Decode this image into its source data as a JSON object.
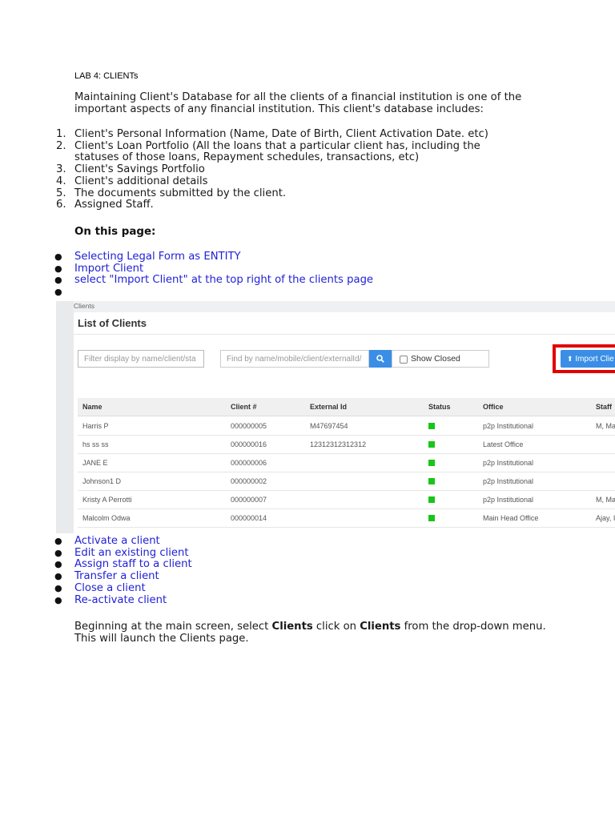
{
  "doc": {
    "title": "LAB 4: CLIENTs",
    "intro": "Maintaining Client's Database for all the clients of a financial institution is one of the important aspects of any financial institution. This client's database includes:",
    "numbered": [
      "Client's Personal Information (Name, Date of Birth, Client Activation Date. etc)",
      "Client's Loan Portfolio (All the loans that a particular client has, including the statuses of those loans, Repayment schedules, transactions, etc)",
      "Client's Savings Portfolio",
      "Client's additional details",
      "The documents submitted by the client.",
      "Assigned Staff."
    ],
    "heading": "On this page:",
    "links1": [
      "Selecting Legal Form as ENTITY",
      "Import Client",
      "select \"Import Client\" at the top right of the clients page",
      ""
    ],
    "links2": [
      " Activate a client",
      "Edit an existing client",
      "Assign staff to a client",
      "Transfer a client",
      "Close a client",
      "Re-activate client"
    ],
    "final": {
      "p1": " Beginning at the main screen, select ",
      "b1": "Clients",
      "p2": " click on ",
      "b2": "Clients",
      "p3": " from the drop-down menu. This will launch the Clients page."
    }
  },
  "screenshot": {
    "breadcrumb": "Clients",
    "panel_title": "List of Clients",
    "filter_placeholder": "Filter display by name/client/sta",
    "search_placeholder": "Find by name/mobile/client/externalId/",
    "show_closed": "Show Closed",
    "import_label": "Import Clie",
    "columns": [
      "Name",
      "Client #",
      "External Id",
      "Status",
      "Office",
      "Staff"
    ],
    "status_color": "#19c519",
    "rows": [
      {
        "name": "Harris P",
        "client_no": "000000005",
        "external_id": "M47697454",
        "office": "p2p Institutional",
        "staff": "M, Ma"
      },
      {
        "name": "hs ss ss",
        "client_no": "000000016",
        "external_id": "12312312312312",
        "office": "Latest Office",
        "staff": ""
      },
      {
        "name": "JANE E",
        "client_no": "000000006",
        "external_id": "",
        "office": "p2p Institutional",
        "staff": ""
      },
      {
        "name": "Johnson1 D",
        "client_no": "000000002",
        "external_id": "",
        "office": "p2p Institutional",
        "staff": ""
      },
      {
        "name": "Kristy A Perrotti",
        "client_no": "000000007",
        "external_id": "",
        "office": "p2p Institutional",
        "staff": "M, Ma"
      },
      {
        "name": "Malcolm Odwa",
        "client_no": "000000014",
        "external_id": "",
        "office": "Main Head Office",
        "staff": "Ajay, I"
      }
    ]
  }
}
